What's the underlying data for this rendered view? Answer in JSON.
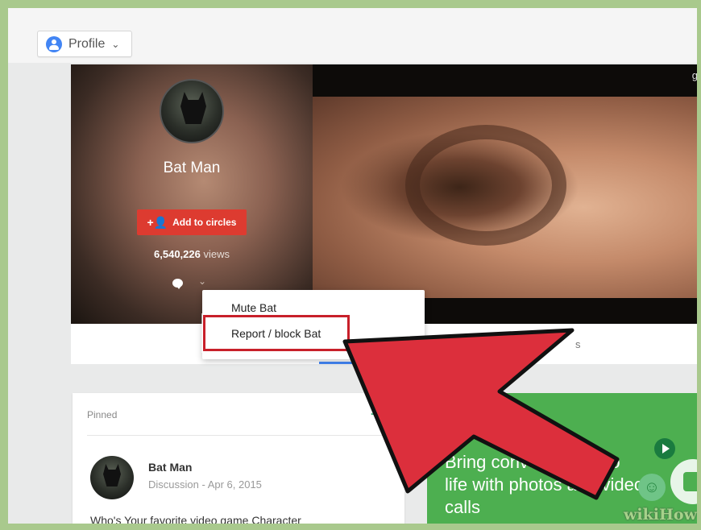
{
  "topbar": {
    "profile_button": {
      "label": "Profile",
      "icon": "account-circle-icon",
      "chevron": "chevron-down-icon"
    }
  },
  "cover": {
    "corner_letter": "g",
    "profile_name": "Bat Man",
    "add_button_label": "Add to circles",
    "views_count": "6,540,226",
    "views_label": " views",
    "tab_fragment": "s"
  },
  "menu": {
    "items": [
      {
        "label": "Mute Bat"
      },
      {
        "label": "Report / block Bat"
      }
    ],
    "highlight_color": "#c8202a"
  },
  "pinned_card": {
    "label": "Pinned",
    "author": "Bat Man",
    "meta": "Discussion - Apr 6, 2015",
    "text": "Who's Your favorite video game Character"
  },
  "green_card": {
    "text": "Bring conversations to life with photos and video calls",
    "visible_text": "L conversa... to life... photos and video... alls",
    "background": "#4daf50"
  },
  "watermark": {
    "text_a": "wiki",
    "text_b": "How"
  },
  "annotation_arrow_color": "#dc2f3c"
}
